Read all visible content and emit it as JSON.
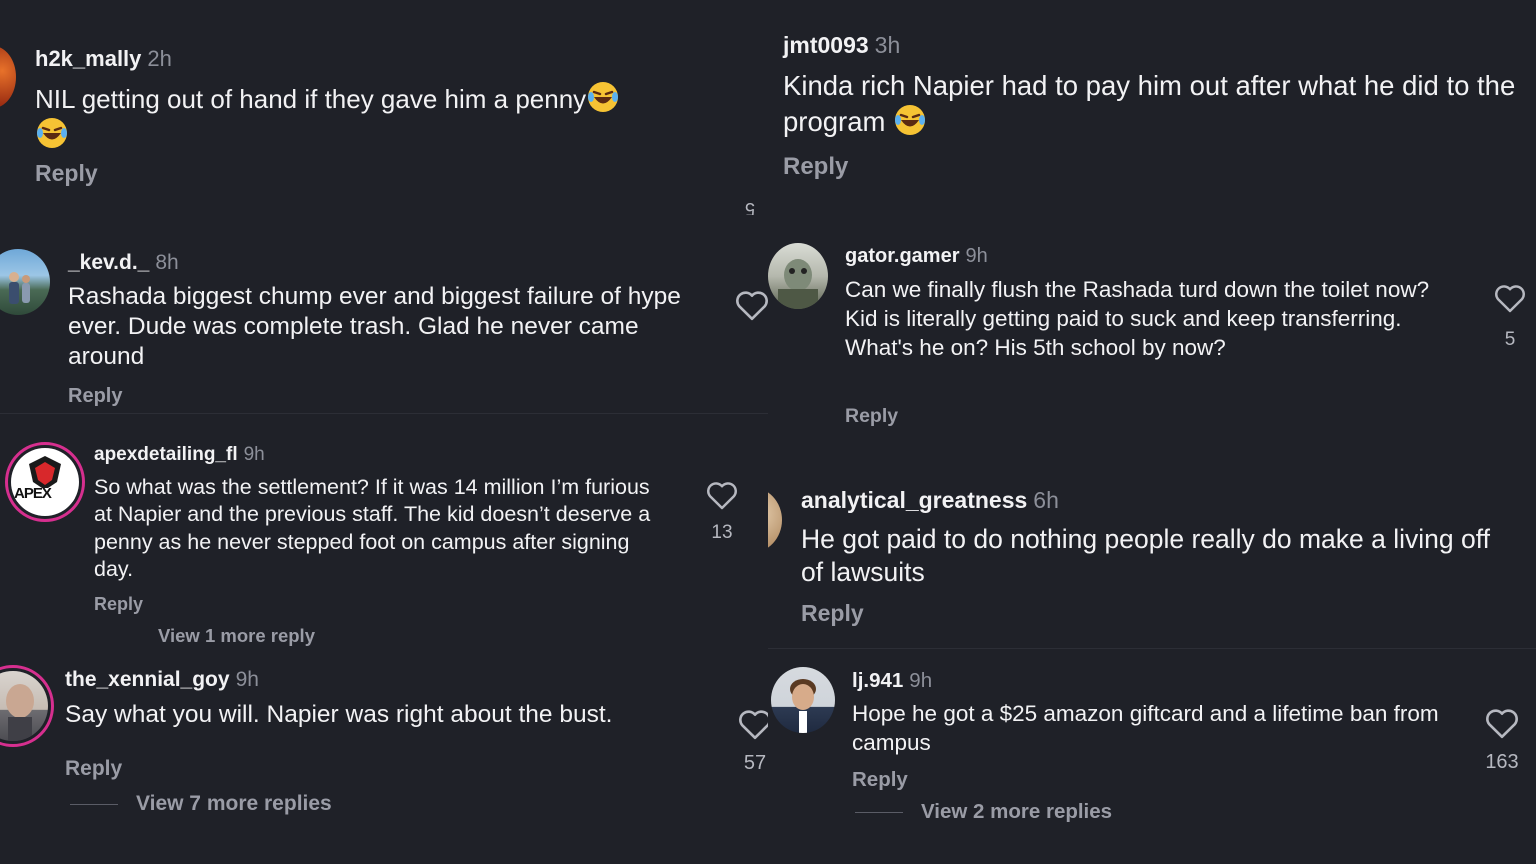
{
  "left": [
    {
      "user": "h2k_mally",
      "time": "2h",
      "text": "NIL getting out of hand if they gave him a penny",
      "emoji_trailing": "😂",
      "reply": "Reply"
    },
    {
      "user": "_kev.d._",
      "time": "8h",
      "text": "Rashada biggest chump ever and biggest failure of hype ever.  Dude was complete trash.  Glad he never came around",
      "reply": "Reply"
    },
    {
      "user": "apexdetailing_fl",
      "time": "9h",
      "text": "So what was the settlement? If it was 14 million I’m furious at Napier and the previous staff. The kid doesn’t deserve a penny as he never stepped foot on campus after signing day.",
      "reply": "Reply",
      "likes": "13",
      "more": "View 1 more reply",
      "avatar_text": "APEX"
    },
    {
      "user": "the_xennial_goy",
      "time": "9h",
      "text": "Say what you will. Napier was right about the bust.",
      "reply": "Reply",
      "likes": "57",
      "more": "View 7 more replies"
    }
  ],
  "right": [
    {
      "user": "jmt0093",
      "time": "3h",
      "text": "Kinda rich Napier had to pay him out after what he did to the program",
      "emoji": "😂",
      "reply": "Reply"
    },
    {
      "user": "gator.gamer",
      "time": "9h",
      "text": "Can we finally flush the Rashada turd down the toilet now? Kid is literally getting paid to suck and keep transferring. What's he on? His 5th school by now?",
      "reply": "Reply",
      "likes": "5"
    },
    {
      "user": "analytical_greatness",
      "time": "6h",
      "text": "He got paid to do nothing people really do make a living off of lawsuits",
      "reply": "Reply"
    },
    {
      "user": "lj.941",
      "time": "9h",
      "text": "Hope he got a $25 amazon giftcard and a lifetime ban from campus",
      "reply": "Reply",
      "likes": "163",
      "more": "View 2 more replies"
    }
  ],
  "stray_count": "5",
  "colors": {
    "bg": "#1f2128",
    "accent_ring": "#d62f8f",
    "muted": "#9a9ca6"
  }
}
